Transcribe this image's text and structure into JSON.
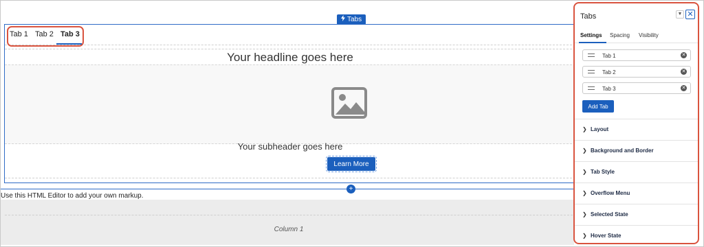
{
  "canvas": {
    "component_chip": "Tabs",
    "tabs": [
      "Tab 1",
      "Tab 2",
      "Tab 3"
    ],
    "headline": "Your headline goes here",
    "subheader": "Your subheader goes here",
    "button": "Learn More",
    "add_symbol": "+",
    "editor_hint": "Use this HTML Editor to add your own markup.",
    "column_label": "Column 1"
  },
  "panel": {
    "title": "Tabs",
    "subtabs": [
      "Settings",
      "Spacing",
      "Visibility"
    ],
    "tab_items": [
      "Tab 1",
      "Tab 2",
      "Tab 3"
    ],
    "add_tab_label": "Add Tab",
    "sections": [
      "Layout",
      "Background and Border",
      "Tab Style",
      "Overflow Menu",
      "Selected State",
      "Hover State"
    ]
  },
  "colors": {
    "accent": "#1b5fbd",
    "highlight": "#d9533e"
  },
  "icons": [
    "lightning-icon",
    "image-placeholder-icon",
    "chevron-down-icon",
    "close-icon",
    "drag-handle-icon",
    "remove-icon",
    "chevron-right-icon"
  ]
}
